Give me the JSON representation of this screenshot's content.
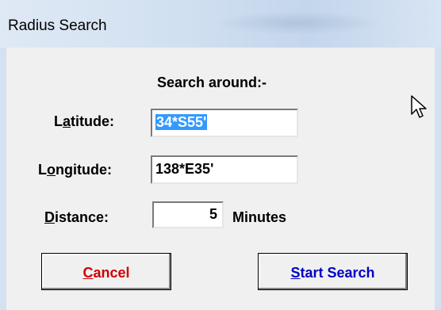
{
  "window": {
    "title": "Radius Search"
  },
  "dialog": {
    "heading": "Search around:-",
    "latitude": {
      "label_prefix": "L",
      "label_accel": "a",
      "label_suffix": "titude:",
      "value": "34*S55'"
    },
    "longitude": {
      "label_prefix": "L",
      "label_accel": "o",
      "label_suffix": "ngitude:",
      "value": "138*E35'"
    },
    "distance": {
      "label_accel": "D",
      "label_suffix": "istance:",
      "value": "5",
      "unit": "Minutes"
    },
    "buttons": {
      "cancel_accel": "C",
      "cancel_rest": "ancel",
      "start_accel": "S",
      "start_rest": "tart Search"
    }
  },
  "icons": {
    "cursor": "mouse-pointer-icon"
  }
}
